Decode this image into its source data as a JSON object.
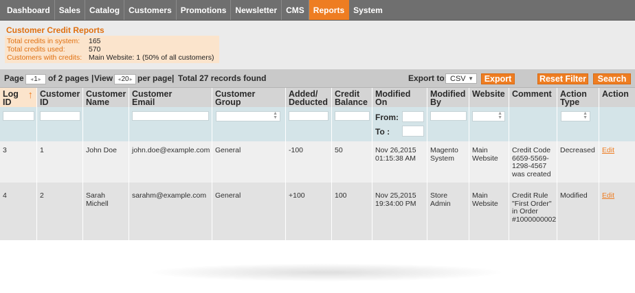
{
  "nav": {
    "items": [
      {
        "label": "Dashboard",
        "active": false
      },
      {
        "label": "Sales",
        "active": false
      },
      {
        "label": "Catalog",
        "active": false
      },
      {
        "label": "Customers",
        "active": false
      },
      {
        "label": "Promotions",
        "active": false
      },
      {
        "label": "Newsletter",
        "active": false
      },
      {
        "label": "CMS",
        "active": false
      },
      {
        "label": "Reports",
        "active": true
      },
      {
        "label": "System",
        "active": false
      }
    ]
  },
  "report": {
    "title": "Customer Credit Reports",
    "stats": [
      {
        "label": "Total credits in system:",
        "value": "165"
      },
      {
        "label": "Total credits used:",
        "value": "570"
      },
      {
        "label": "Customers with credits:",
        "value": "Main Website: 1 (50% of all customers)"
      }
    ]
  },
  "pager": {
    "page_label": "Page",
    "page_value": "1",
    "of_pages": "of 2 pages",
    "view_label": "View",
    "per_page_value": "20",
    "per_page_label": "per page",
    "total": "Total 27 records found",
    "export_to_label": "Export to:",
    "export_format": "CSV",
    "export_button": "Export",
    "reset_button": "Reset Filter",
    "search_button": "Search"
  },
  "grid": {
    "headers": {
      "log_id": "Log ID",
      "customer_id": "Customer ID",
      "customer_name": "Customer Name",
      "customer_email": "Customer Email",
      "customer_group": "Customer Group",
      "added_deducted": "Added/ Deducted",
      "credit_balance": "Credit Balance",
      "modified_on": "Modified On",
      "modified_by": "Modified By",
      "website": "Website",
      "comment": "Comment",
      "action_type": "Action Type",
      "action": "Action"
    },
    "filter": {
      "from_label": "From:",
      "to_label": "To :"
    },
    "rows": [
      {
        "log_id": "3",
        "customer_id": "1",
        "customer_name": "John Doe",
        "customer_email": "john.doe@example.com",
        "customer_group": "General",
        "added_deducted": "-100",
        "credit_balance": "50",
        "modified_on": "Nov 26,2015 01:15:38 AM",
        "modified_by": "Magento System",
        "website": "Main Website",
        "comment": "Credit Code 6659-5569-1298-4567 was created",
        "action_type": "Decreased",
        "action": "Edit"
      },
      {
        "log_id": "4",
        "customer_id": "2",
        "customer_name": "Sarah Michell",
        "customer_email": "sarahm@example.com",
        "customer_group": "General",
        "added_deducted": "+100",
        "credit_balance": "100",
        "modified_on": "Nov 25,2015 19:34:00 PM",
        "modified_by": "Store Admin",
        "website": "Main Website",
        "comment": "Credit Rule \"First Order\" in Order #1000000002",
        "action_type": "Modified",
        "action": "Edit"
      }
    ]
  },
  "colors": {
    "accent": "#ee7d22",
    "nav_bg": "#6f6f6f",
    "header_bg": "#d4d4d4",
    "filter_bg": "#d4e4e8"
  }
}
